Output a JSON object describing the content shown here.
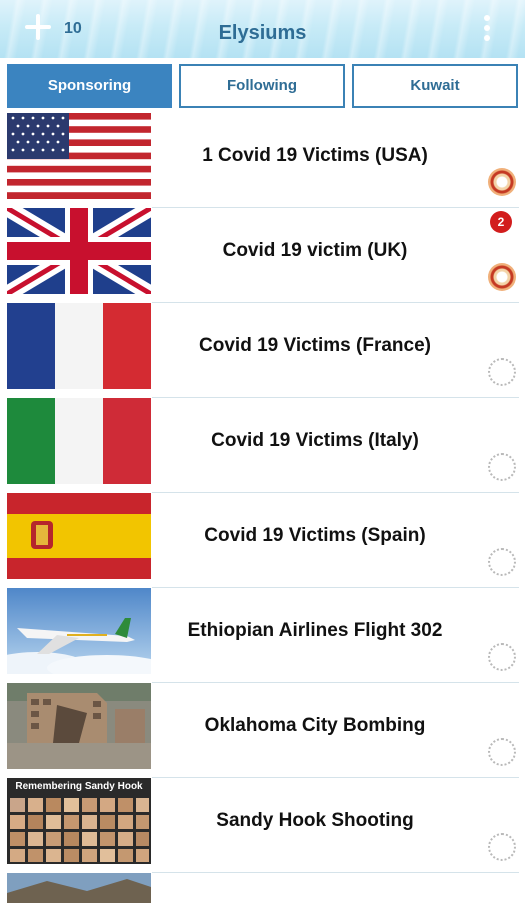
{
  "header": {
    "count": "10",
    "title": "Elysiums"
  },
  "tabs": [
    {
      "label": "Sponsoring",
      "active": true
    },
    {
      "label": "Following",
      "active": false
    },
    {
      "label": "Kuwait",
      "active": false
    }
  ],
  "items": [
    {
      "title": "1 Covid 19 Victims (USA)",
      "thumb": "usa-flag-image",
      "icon": "flower-wreath-icon"
    },
    {
      "title": "Covid 19 victim (UK)",
      "thumb": "uk-flag-image",
      "icon": "flower-wreath-icon",
      "notification": "2"
    },
    {
      "title": "Covid 19 Victims (France)",
      "thumb": "france-flag-image",
      "icon": "laurel-wreath-icon"
    },
    {
      "title": "Covid 19 Victims (Italy)",
      "thumb": "italy-flag-image",
      "icon": "laurel-wreath-icon"
    },
    {
      "title": "Covid 19 Victims (Spain)",
      "thumb": "spain-flag-image",
      "icon": "laurel-wreath-icon"
    },
    {
      "title": "Ethiopian Airlines Flight 302",
      "thumb": "airplane-image",
      "icon": "laurel-wreath-icon"
    },
    {
      "title": "Oklahoma City Bombing",
      "thumb": "building-image",
      "icon": "laurel-wreath-icon"
    },
    {
      "title": "Sandy Hook Shooting",
      "thumb": "memorial-image",
      "thumb_caption": "Remembering Sandy Hook",
      "icon": "laurel-wreath-icon"
    }
  ],
  "colors": {
    "accent": "#3b84c0",
    "title": "#2f6d95",
    "badge": "#d21d1d"
  }
}
